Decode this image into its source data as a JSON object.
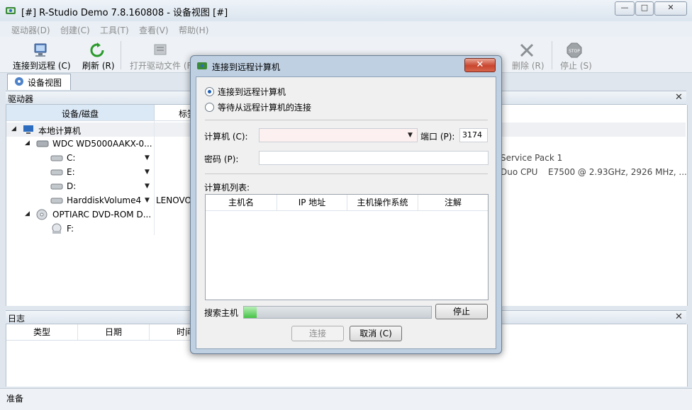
{
  "window": {
    "title": "[#] R-Studio Demo 7.8.160808 - 设备视图 [#]",
    "controls": {
      "minimize": "—",
      "maximize": "□",
      "close": "✕"
    }
  },
  "menu": [
    "驱动器(D)",
    "创建(C)",
    "工具(T)",
    "查看(V)",
    "帮助(H)"
  ],
  "toolbar": {
    "connect_remote": "连接到远程 (C)",
    "refresh": "刷新 (R)",
    "open_drive_files": "打开驱动文件 (F)",
    "delete": "删除 (R)",
    "stop": "停止 (S)"
  },
  "tabs": {
    "device_view": "设备视图"
  },
  "drives_panel": {
    "title": "驱动器",
    "col_device": "设备/磁盘",
    "col_label": "标签",
    "rows": {
      "local_computer": "本地计算机",
      "wdc": "WDC WD5000AAKX-0...",
      "c": "C:",
      "e": "E:",
      "d": "D:",
      "hdv4": "HarddiskVolume4",
      "hdv4_label": "LENOVO",
      "optiarc": "OPTIARC DVD-ROM D...",
      "f": "F:"
    },
    "right_text_1": "Service Pack 1",
    "right_text_2a": "Duo CPU",
    "right_text_2b": "E7500  @ 2.93GHz, 2926 MHz, ..."
  },
  "log_panel": {
    "title": "日志",
    "col_type": "类型",
    "col_date": "日期",
    "col_time": "时间"
  },
  "statusbar": {
    "text": "准备"
  },
  "dialog": {
    "title": "连接到远程计算机",
    "close": "✕",
    "radio_connect": "连接到远程计算机",
    "radio_wait": "等待从远程计算机的连接",
    "computer_label": "计算机 (C):",
    "computer_value": "",
    "port_label": "端口 (P):",
    "port_value": "3174",
    "password_label": "密码 (P):",
    "password_value": "",
    "list_label": "计算机列表:",
    "list_columns": [
      "主机名",
      "IP 地址",
      "主机操作系统",
      "注解"
    ],
    "search_label": "搜索主机",
    "stop_button": "停止",
    "connect_button": "连接",
    "cancel_button": "取消 (C)"
  }
}
